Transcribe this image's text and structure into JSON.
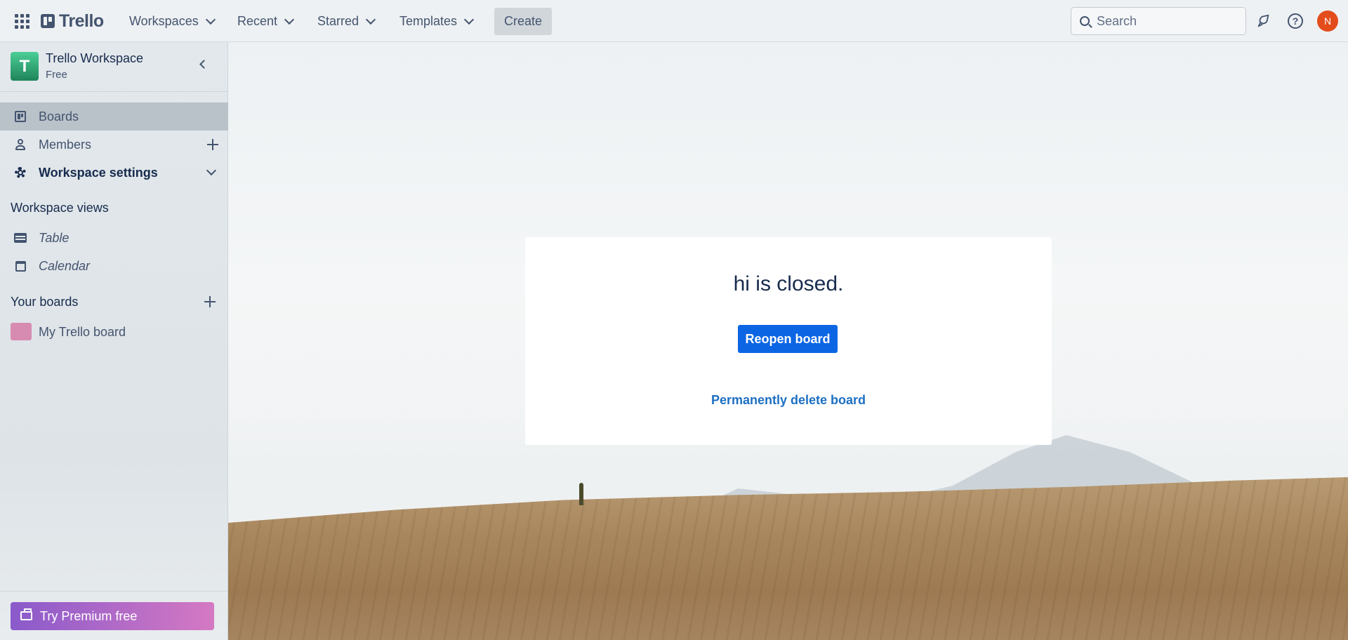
{
  "header": {
    "logo_text": "Trello",
    "nav": [
      {
        "label": "Workspaces"
      },
      {
        "label": "Recent"
      },
      {
        "label": "Starred"
      },
      {
        "label": "Templates"
      }
    ],
    "create_label": "Create",
    "search_placeholder": "Search",
    "avatar_initial": "N"
  },
  "sidebar": {
    "workspace_name": "Trello Workspace",
    "workspace_initial": "T",
    "workspace_plan": "Free",
    "items": [
      {
        "label": "Boards"
      },
      {
        "label": "Members"
      },
      {
        "label": "Workspace settings"
      }
    ],
    "views_heading": "Workspace views",
    "views": [
      {
        "label": "Table"
      },
      {
        "label": "Calendar"
      }
    ],
    "boards_heading": "Your boards",
    "boards": [
      {
        "label": "My Trello board",
        "color": "#d88bb1"
      }
    ],
    "premium_label": "Try Premium free"
  },
  "main": {
    "closed_title": "hi is closed.",
    "reopen_label": "Reopen board",
    "delete_label": "Permanently delete board"
  },
  "colors": {
    "primary": "#0c66e4",
    "avatar": "#e34c1b",
    "workspace_tile": "#1f845a"
  }
}
